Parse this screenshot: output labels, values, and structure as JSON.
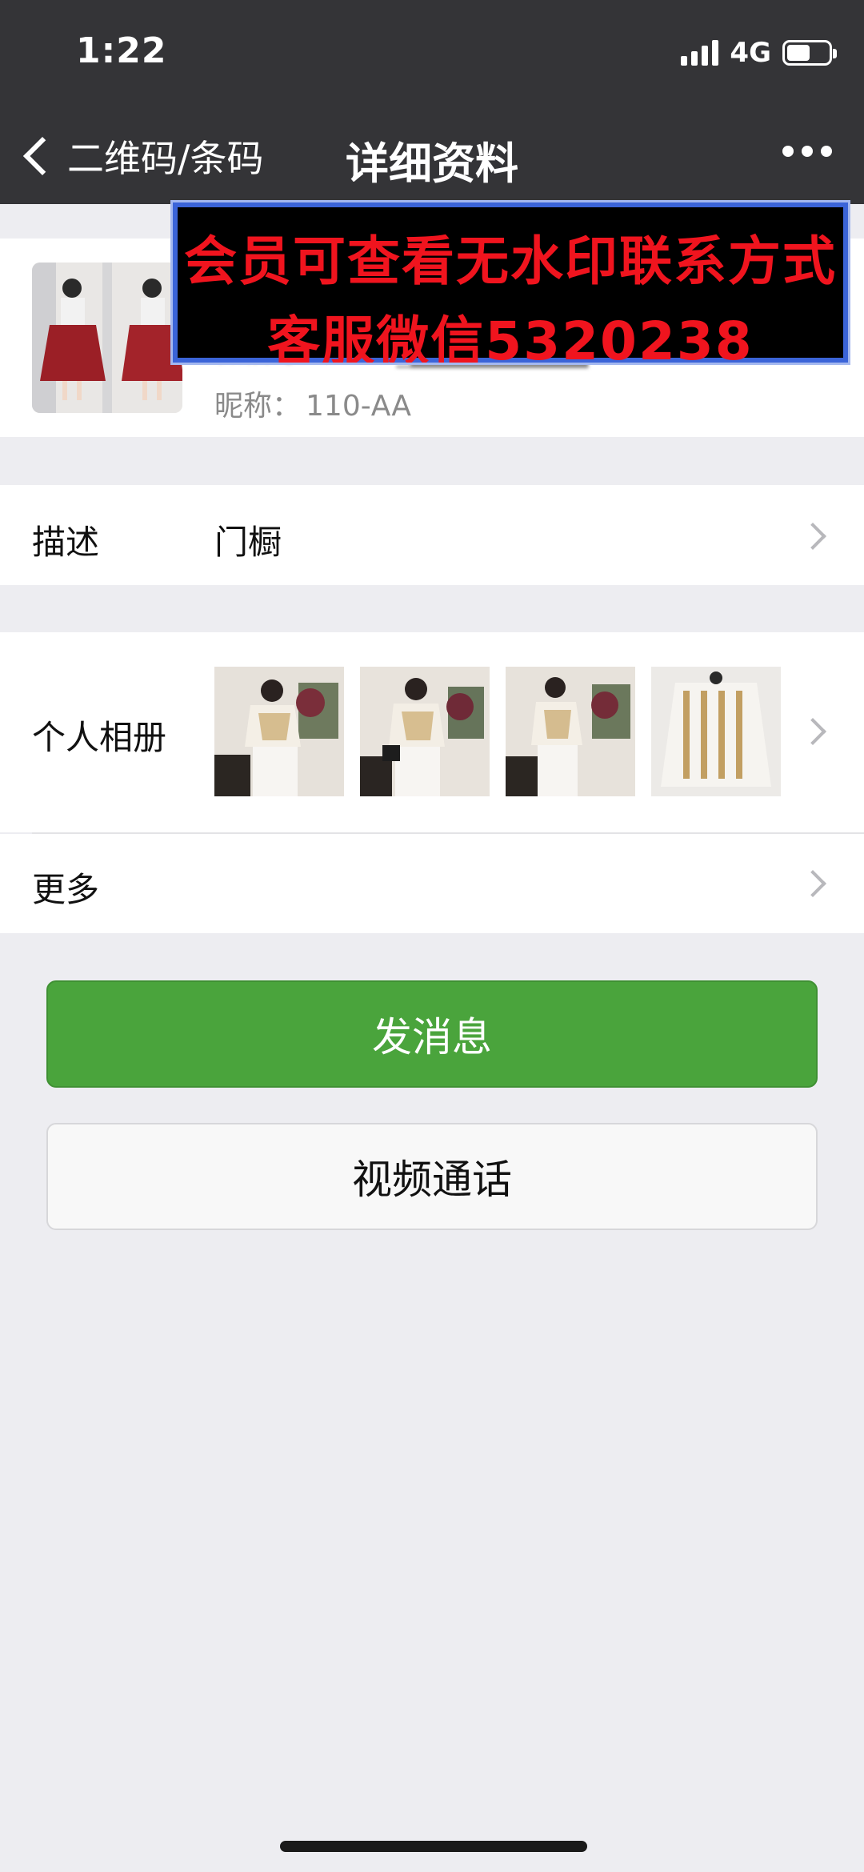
{
  "status_bar": {
    "time": "1:22",
    "network": "4G",
    "battery_percent": 55,
    "signal_bars": 4
  },
  "nav": {
    "back_label": "二维码/条码",
    "title": "详细资料"
  },
  "profile": {
    "wechat_id": "微信号：wxid_████████",
    "nickname_label": "昵称：",
    "nickname_value": "110-AA"
  },
  "watermark": {
    "line1": "会员可查看无水印联系方式",
    "line2": "客服微信5320238"
  },
  "description": {
    "label": "描述",
    "value": "门橱"
  },
  "album": {
    "label": "个人相册",
    "photo_count": 4
  },
  "more": {
    "label": "更多"
  },
  "buttons": {
    "message": "发消息",
    "video_call": "视频通话"
  },
  "colors": {
    "nav_bg": "#343437",
    "accent_green": "#4aa43c",
    "page_bg": "#ededf1",
    "watermark_text": "#f0141e"
  }
}
